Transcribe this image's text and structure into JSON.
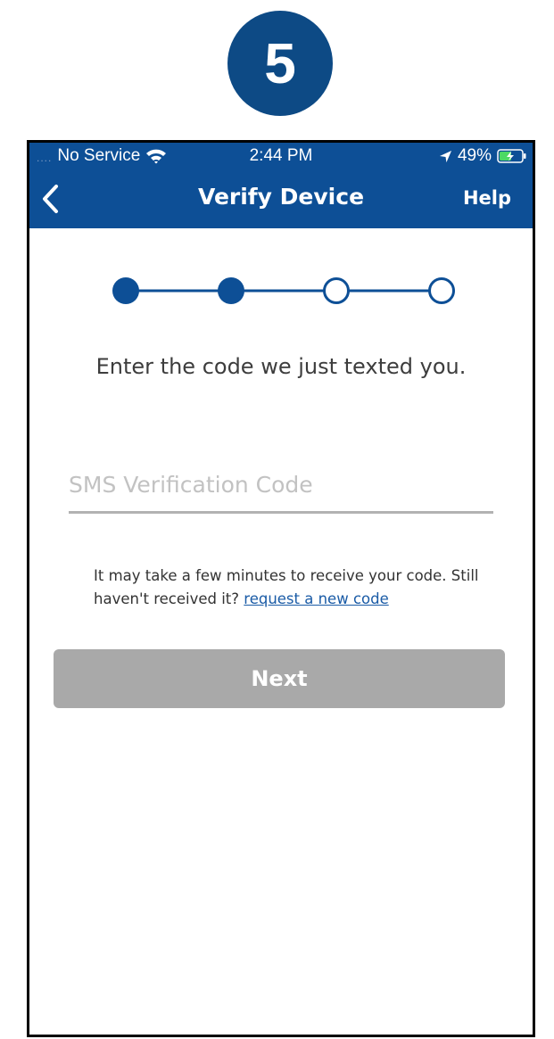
{
  "step_badge": "5",
  "status_bar": {
    "signal": "....",
    "carrier": "No Service",
    "time": "2:44 PM",
    "battery": "49%"
  },
  "nav": {
    "title": "Verify Device",
    "help_label": "Help",
    "back_icon": "chevron-left-icon"
  },
  "stepper": {
    "total_steps": 4,
    "completed_steps": 2
  },
  "instruction": "Enter the code we just texted you.",
  "code_input": {
    "placeholder": "SMS Verification Code",
    "value": ""
  },
  "helper": {
    "text": "It may take a few minutes to receive your code. Still haven't received it?",
    "link_label": "request a new code"
  },
  "next_button": {
    "label": "Next",
    "disabled": true
  },
  "colors": {
    "brand_blue": "#0d4f96",
    "badge_blue": "#0d4a85",
    "battery_green": "#4cd964",
    "disabled_gray": "#a9a9a9",
    "link_blue": "#1a5ba6"
  }
}
